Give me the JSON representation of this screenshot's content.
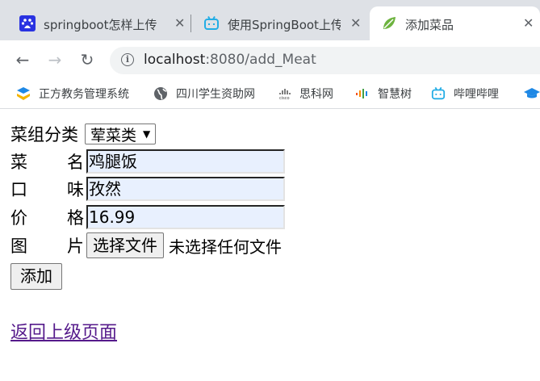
{
  "browser": {
    "tabs": [
      {
        "title": "springboot怎样上传",
        "icon": "baidu-icon",
        "active": false
      },
      {
        "title": "使用SpringBoot上传",
        "icon": "bilibili-icon",
        "active": false
      },
      {
        "title": "添加菜品",
        "icon": "spring-leaf-icon",
        "active": true
      }
    ],
    "url_host": "localhost",
    "url_rest": ":8080/add_Meat",
    "bookmarks": [
      {
        "label": "正方教务管理系统",
        "icon": "zf-icon"
      },
      {
        "label": "四川学生资助网",
        "icon": "globe-icon"
      },
      {
        "label": "思科网",
        "icon": "cisco-icon"
      },
      {
        "label": "智慧树",
        "icon": "zhihuishu-icon"
      },
      {
        "label": "哔哩哔哩",
        "icon": "bilibili-icon"
      }
    ]
  },
  "form": {
    "category_label": "菜组分类",
    "category_value": "荤菜类",
    "name_label": [
      "菜",
      "名"
    ],
    "name_value": "鸡腿饭",
    "taste_label": [
      "口",
      "味"
    ],
    "taste_value": "孜然",
    "price_label": [
      "价",
      "格"
    ],
    "price_value": "16.99",
    "image_label": [
      "图",
      "片"
    ],
    "file_button": "选择文件",
    "file_status": "未选择任何文件",
    "submit_label": "添加",
    "back_link": "返回上级页面"
  }
}
